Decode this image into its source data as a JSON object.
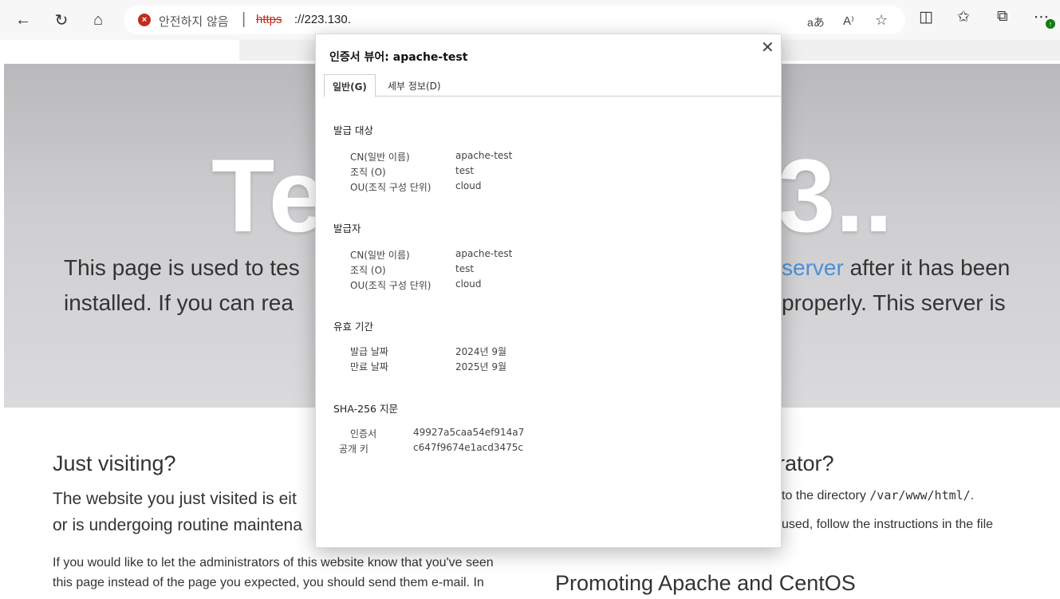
{
  "browser": {
    "security_status": "안전하지 않음",
    "url_scheme": "https",
    "url_host": "://223.130.",
    "icons": [
      "back-icon",
      "refresh-icon",
      "home-icon",
      "translate-icon",
      "read-aloud-icon",
      "favorite-star-icon",
      "split-screen-icon",
      "favorites-icon",
      "collections-icon",
      "more-icon"
    ]
  },
  "page": {
    "banner_title_left": "Te",
    "banner_title_right": "3..",
    "lead_line1_left": "This page is used to tes",
    "lead_line1_link": "server",
    "lead_line1_right": " after it has been",
    "lead_line2_left": "installed. If you can rea",
    "lead_line2_right": "properly. This server is",
    "visiting_heading": "Just visiting?",
    "visiting_p1": "The website you just visited is eit",
    "visiting_p2": "or is undergoing routine maintena",
    "visiting_small1": "If you would like to let the administrators of this website know that you've seen",
    "visiting_small2": "this page instead of the page you expected, you should send them e-mail. In",
    "admin_heading_tail": "rator?",
    "admin_p1_text": "to the directory ",
    "admin_p1_path": "/var/www/html/",
    "admin_p1_end": ".",
    "admin_p2": "used, follow the instructions in the file",
    "promo_heading": "Promoting Apache and CentOS"
  },
  "dialog": {
    "title": "인증서 뷰어: apache-test",
    "tab_general": "일반(G)",
    "tab_details": "세부 정보(D)",
    "issued_to": {
      "heading": "발급 대상",
      "rows": [
        {
          "label": "CN(일반 이름)",
          "value": "apache-test"
        },
        {
          "label": "조직 (O)",
          "value": "test"
        },
        {
          "label": "OU(조직 구성 단위)",
          "value": "cloud"
        }
      ]
    },
    "issued_by": {
      "heading": "발급자",
      "rows": [
        {
          "label": "CN(일반 이름)",
          "value": "apache-test"
        },
        {
          "label": "조직 (O)",
          "value": "test"
        },
        {
          "label": "OU(조직 구성 단위)",
          "value": "cloud"
        }
      ]
    },
    "validity": {
      "heading": "유효 기간",
      "rows": [
        {
          "label": "발급 날짜",
          "value": "2024년 9월"
        },
        {
          "label": "만료 날짜",
          "value": "2025년 9월"
        }
      ]
    },
    "fingerprints": {
      "heading": "SHA-256 지문",
      "rows": [
        {
          "label": "인증서",
          "value": "49927a5caa54ef914a7"
        },
        {
          "label": "공개 키",
          "value": "c647f9674e1acd3475c"
        }
      ]
    }
  }
}
